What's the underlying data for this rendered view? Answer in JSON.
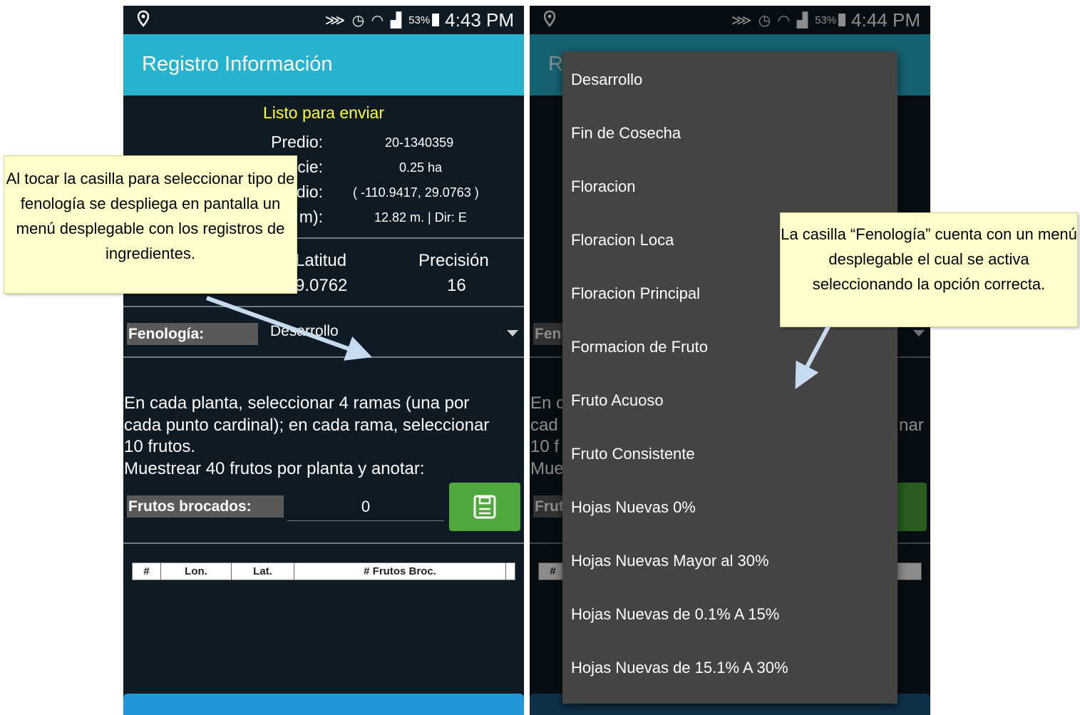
{
  "left_screen": {
    "status": {
      "battery": "53%",
      "time": "4:43 PM"
    },
    "title": "Registro Información",
    "ready_text": "Listo para enviar",
    "fields": [
      {
        "label": "Predio:",
        "value": "20-1340359"
      },
      {
        "label": "cie:",
        "value": "0.25 ha"
      },
      {
        "label": "dio:",
        "value": "( -110.9417, 29.0763 )"
      },
      {
        "label": "m):",
        "value": "12.82 m. | Dir: E"
      }
    ],
    "lat_header": "Latitud",
    "lat_value": "9.0762",
    "prec_header": "Precisión",
    "prec_value": "16",
    "fenologia_label": "Fenología:",
    "fenologia_value": "Desarrollo",
    "instructions": [
      "En cada planta, seleccionar 4 ramas (una por",
      "cada punto cardinal); en cada rama, seleccionar",
      "10 frutos.",
      "Muestrear 40 frutos por planta y anotar:"
    ],
    "frutos_label": "Frutos brocados:",
    "frutos_value": "0",
    "table_headers": [
      "#",
      "Lon.",
      "Lat.",
      "# Frutos Broc."
    ]
  },
  "right_screen": {
    "status": {
      "battery": "53%",
      "time": "4:44 PM"
    },
    "behind": {
      "title_fragment": "R",
      "fen_fragment": "Fen",
      "frut_fragment": "Frut",
      "instr_fragments": [
        "En c",
        "cad",
        "10 f",
        "Mue"
      ],
      "instr_right": "nar",
      "table_fragment": "#"
    },
    "dropdown_items": [
      "Desarrollo",
      "Fin de Cosecha",
      "Floracion",
      "Floracion Loca",
      "Floracion Principal",
      "Formacion de Fruto",
      "Fruto Acuoso",
      "Fruto Consistente",
      "Hojas Nuevas 0%",
      "Hojas Nuevas Mayor al 30%",
      "Hojas Nuevas de 0.1% A 15%",
      "Hojas Nuevas de 15.1% A 30%"
    ]
  },
  "callouts": {
    "left": "Al tocar la casilla para seleccionar tipo de fenología se despliega en pantalla un menú desplegable con los registros de ingredientes.",
    "right": "La casilla “Fenología” cuenta con un menú desplegable el cual se activa seleccionando la opción correcta."
  },
  "colors": {
    "appbar": "#26b3d0",
    "screen_bg": "#0e1a24",
    "ready_text": "#ffff33",
    "save_button": "#4fa83c",
    "dropdown_bg": "#444444",
    "callout_bg": "#ffffcc",
    "arrow": "#c6dbef"
  }
}
